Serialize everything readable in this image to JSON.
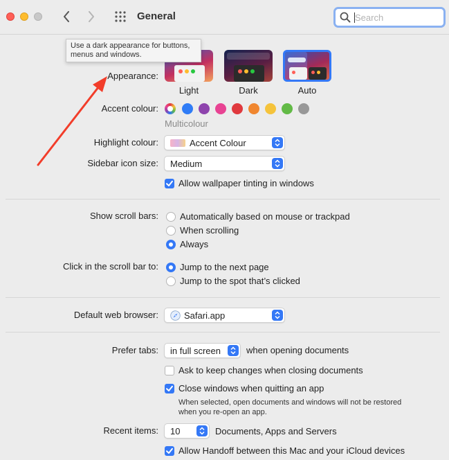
{
  "window": {
    "title": "General"
  },
  "search": {
    "placeholder": "Search"
  },
  "tooltip": {
    "line1": "Use a dark appearance for buttons,",
    "line2": "menus and windows."
  },
  "appearance": {
    "label": "Appearance:",
    "options": [
      "Light",
      "Dark",
      "Auto"
    ],
    "selected": "Auto"
  },
  "accent": {
    "label": "Accent colour:",
    "selected_name": "Multicolour",
    "colors": [
      "multicolour",
      "#2f7cf6",
      "#8e44ad",
      "#e84393",
      "#e0393e",
      "#f0862f",
      "#f5c33b",
      "#62ba46",
      "#989898"
    ]
  },
  "highlight": {
    "label": "Highlight colour:",
    "value": "Accent Colour"
  },
  "sidebar_icon_size": {
    "label": "Sidebar icon size:",
    "value": "Medium"
  },
  "wallpaper_tinting": {
    "label": "Allow wallpaper tinting in windows",
    "checked": true
  },
  "scroll_bars": {
    "label": "Show scroll bars:",
    "options": [
      "Automatically based on mouse or trackpad",
      "When scrolling",
      "Always"
    ],
    "selected": "Always"
  },
  "click_scroll": {
    "label": "Click in the scroll bar to:",
    "options": [
      "Jump to the next page",
      "Jump to the spot that’s clicked"
    ],
    "selected": "Jump to the next page"
  },
  "browser": {
    "label": "Default web browser:",
    "value": "Safari.app"
  },
  "tabs": {
    "label": "Prefer tabs:",
    "value": "in full screen",
    "suffix": "when opening documents"
  },
  "ask_keep_changes": {
    "label": "Ask to keep changes when closing documents",
    "checked": false
  },
  "close_windows": {
    "label": "Close windows when quitting an app",
    "checked": true,
    "note_line1": "When selected, open documents and windows will not be restored",
    "note_line2": "when you re-open an app."
  },
  "recent_items": {
    "label": "Recent items:",
    "value": "10",
    "suffix": "Documents, Apps and Servers"
  },
  "handoff": {
    "label": "Allow Handoff between this Mac and your iCloud devices",
    "checked": true
  },
  "colors": {
    "accent": "#3478f6",
    "annotation_arrow": "#f23d2a"
  }
}
